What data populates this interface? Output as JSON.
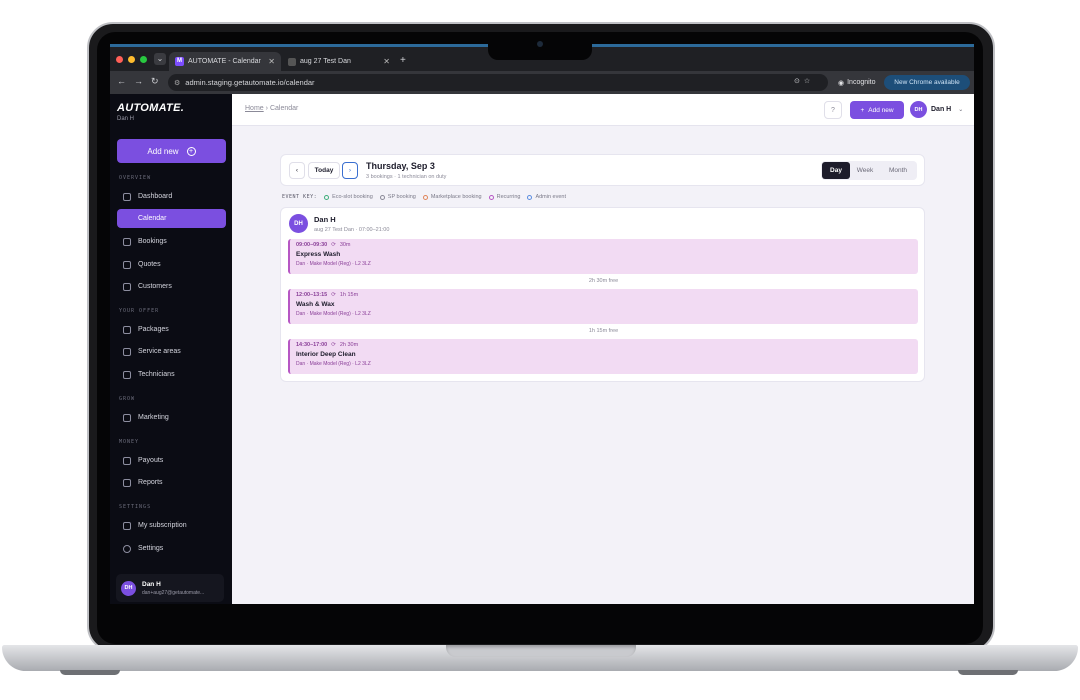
{
  "browser": {
    "tabs": [
      {
        "title": "AUTOMATE - Calendar",
        "favicon": "M",
        "active": true
      },
      {
        "title": "aug 27 Test Dan",
        "active": false
      }
    ],
    "url": "admin.staging.getautomate.io/calendar",
    "incognito_label": "Incognito",
    "update_label": "New Chrome available"
  },
  "sidebar": {
    "brand": "AUTOMATE.",
    "brand_user": "Dan H",
    "add_new_label": "Add new",
    "sections": [
      {
        "title": "OVERVIEW",
        "items": [
          {
            "label": "Dashboard",
            "icon": "home-icon"
          },
          {
            "label": "Calendar",
            "icon": "calendar-icon",
            "active": true
          },
          {
            "label": "Bookings",
            "icon": "bookings-icon"
          },
          {
            "label": "Quotes",
            "icon": "tag-icon"
          },
          {
            "label": "Customers",
            "icon": "car-icon"
          }
        ]
      },
      {
        "title": "YOUR OFFER",
        "items": [
          {
            "label": "Packages",
            "icon": "package-icon"
          },
          {
            "label": "Service areas",
            "icon": "map-pin-icon"
          },
          {
            "label": "Technicians",
            "icon": "user-icon"
          }
        ]
      },
      {
        "title": "GROW",
        "items": [
          {
            "label": "Marketing",
            "icon": "star-icon"
          }
        ]
      },
      {
        "title": "MONEY",
        "items": [
          {
            "label": "Payouts",
            "icon": "payout-icon"
          },
          {
            "label": "Reports",
            "icon": "report-icon"
          }
        ]
      },
      {
        "title": "SETTINGS",
        "items": [
          {
            "label": "My subscription",
            "icon": "subscription-icon"
          },
          {
            "label": "Settings",
            "icon": "gear-icon"
          }
        ]
      }
    ],
    "user": {
      "initials": "DH",
      "name": "Dan H",
      "email": "dan+aug27@getautomate..."
    }
  },
  "header": {
    "breadcrumb_home": "Home",
    "breadcrumb_sep": "›",
    "breadcrumb_current": "Calendar",
    "help_icon": "question-icon",
    "add_new_label": "Add new",
    "user_initials": "DH",
    "user_name": "Dan H"
  },
  "toolbar": {
    "today_label": "Today",
    "date_title": "Thursday, Sep 3",
    "date_subtitle": "3 bookings · 1 technician on duty",
    "views": [
      "Day",
      "Week",
      "Month"
    ],
    "selected_view": "Day"
  },
  "event_key": {
    "label": "EVENT KEY:",
    "items": [
      {
        "label": "Eco-slot booking",
        "color": "#3fae7a"
      },
      {
        "label": "SP booking",
        "color": "#8b8a98"
      },
      {
        "label": "Marketplace booking",
        "color": "#e0855a"
      },
      {
        "label": "Recurring",
        "color": "#b657c4"
      },
      {
        "label": "Admin event",
        "color": "#5b8de0"
      }
    ]
  },
  "technician": {
    "initials": "DH",
    "name": "Dan H",
    "meta": "aug 27 Test Dan · 07:00–21:00"
  },
  "bookings": [
    {
      "time": "09:00–09:30",
      "duration": "30m",
      "title": "Express Wash",
      "details": "Dan · Make Model (Reg) · L2 3LZ"
    },
    {
      "time": "12:00–13:15",
      "duration": "1h 15m",
      "title": "Wash & Wax",
      "details": "Dan · Make Model (Reg) · L2 3LZ"
    },
    {
      "time": "14:30–17:00",
      "duration": "2h 30m",
      "title": "Interior Deep Clean",
      "details": "Dan · Make Model (Reg) · L2 3LZ"
    }
  ],
  "gaps": [
    "2h 30m free",
    "1h 15m free"
  ],
  "colors": {
    "accent": "#7b4fe0",
    "booking_bg": "#f2dbf3",
    "booking_border": "#b657c4",
    "sidebar_bg": "#0b0c14"
  }
}
